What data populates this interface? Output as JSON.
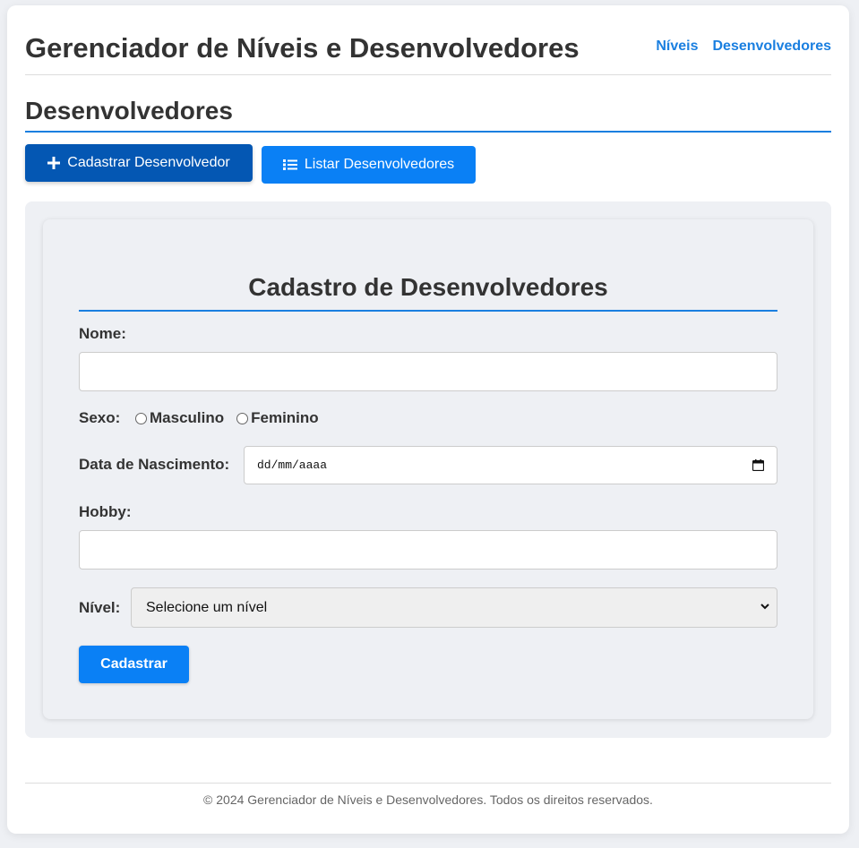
{
  "header": {
    "title": "Gerenciador de Níveis e Desenvolvedores",
    "nav": [
      "Níveis",
      "Desenvolvedores"
    ]
  },
  "section": {
    "title": "Desenvolvedores"
  },
  "actions": {
    "register_label": "Cadastrar Desenvolvedor",
    "list_label": "Listar Desenvolvedores"
  },
  "form": {
    "title": "Cadastro de Desenvolvedores",
    "name_label": "Nome:",
    "name_value": "",
    "sex_label": "Sexo:",
    "sex_options": [
      "Masculino",
      "Feminino"
    ],
    "birth_label": "Data de Nascimento:",
    "birth_placeholder": "dd/mm/aaaa",
    "hobby_label": "Hobby:",
    "hobby_value": "",
    "level_label": "Nível:",
    "level_selected": "Selecione um nível",
    "submit_label": "Cadastrar"
  },
  "footer": {
    "text": "© 2024 Gerenciador de Níveis e Desenvolvedores. Todos os direitos reservados."
  },
  "colors": {
    "accent": "#1a7fe0",
    "button": "#0a80f5",
    "button_active": "#0457b3"
  }
}
